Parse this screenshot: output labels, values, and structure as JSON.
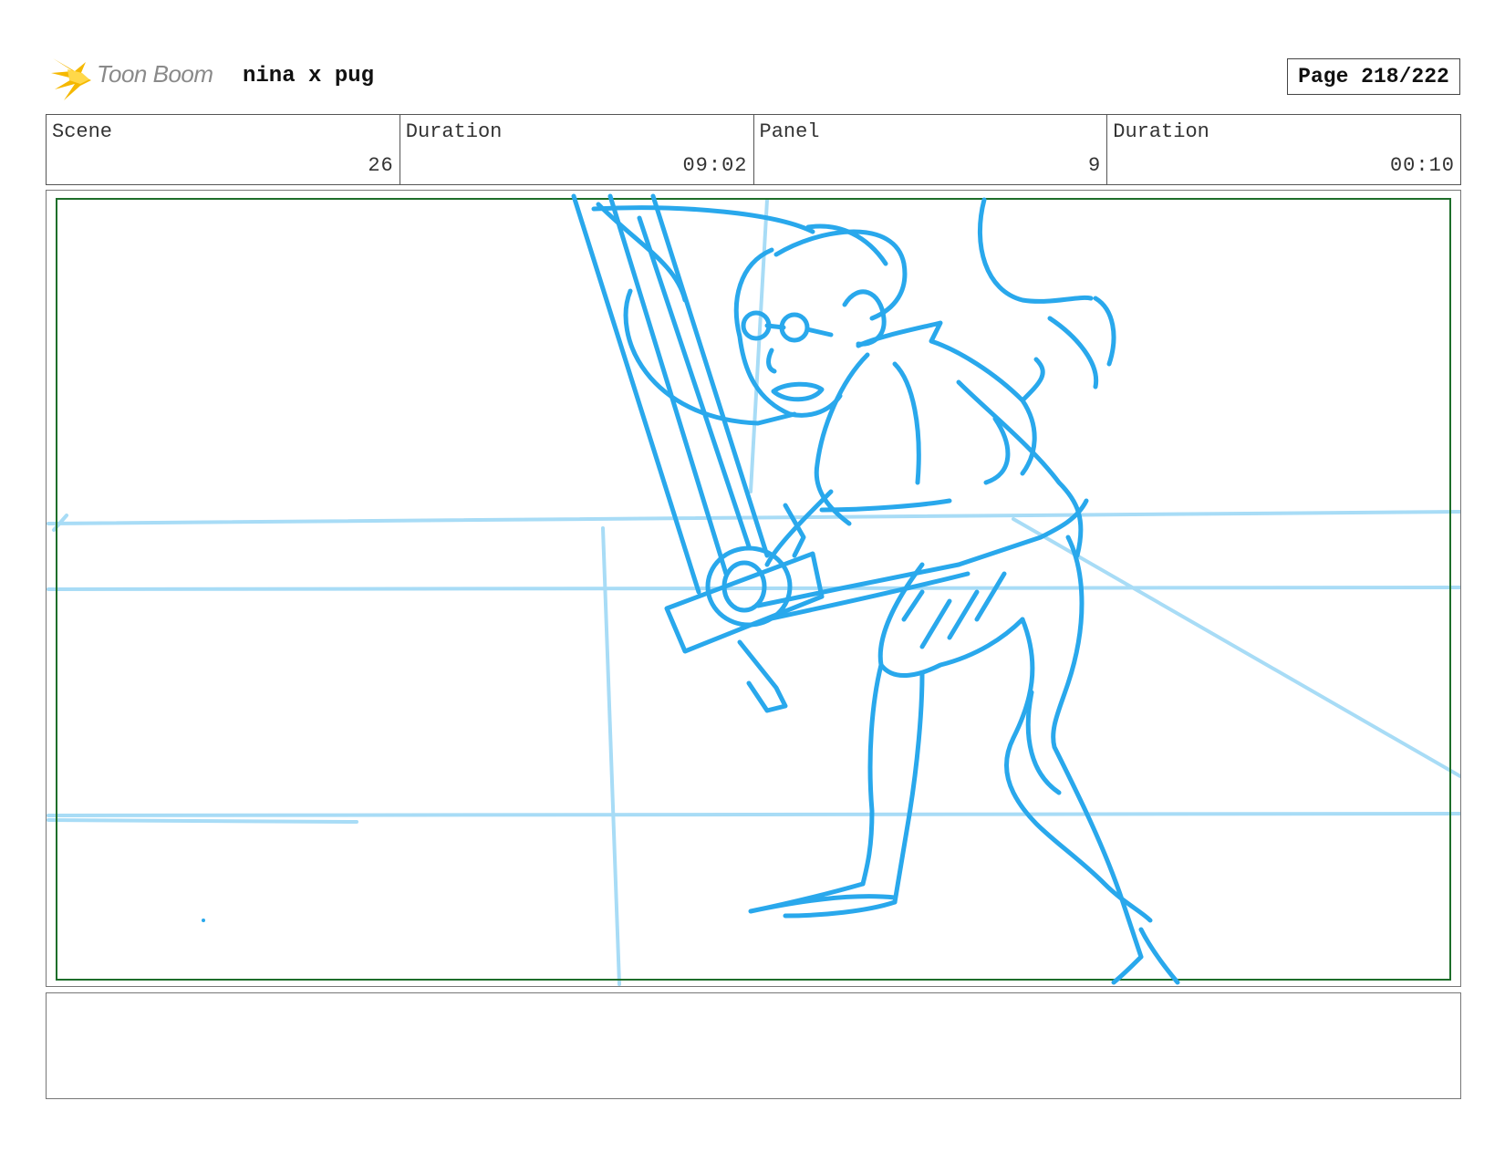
{
  "header": {
    "logo_text": "Toon Boom",
    "project_title": "nina x pug",
    "page_label": "Page 218/222"
  },
  "info": {
    "scene_label": "Scene",
    "scene_value": "26",
    "scene_duration_label": "Duration",
    "scene_duration_value": "09:02",
    "panel_label": "Panel",
    "panel_value": "9",
    "panel_duration_label": "Duration",
    "panel_duration_value": "00:10"
  },
  "colors": {
    "sketch": "#29a8ec",
    "guide": "#a8dcf6",
    "frame": "#1e6e2a",
    "logo_accent": "#f5b800"
  },
  "notes": {
    "text": ""
  }
}
